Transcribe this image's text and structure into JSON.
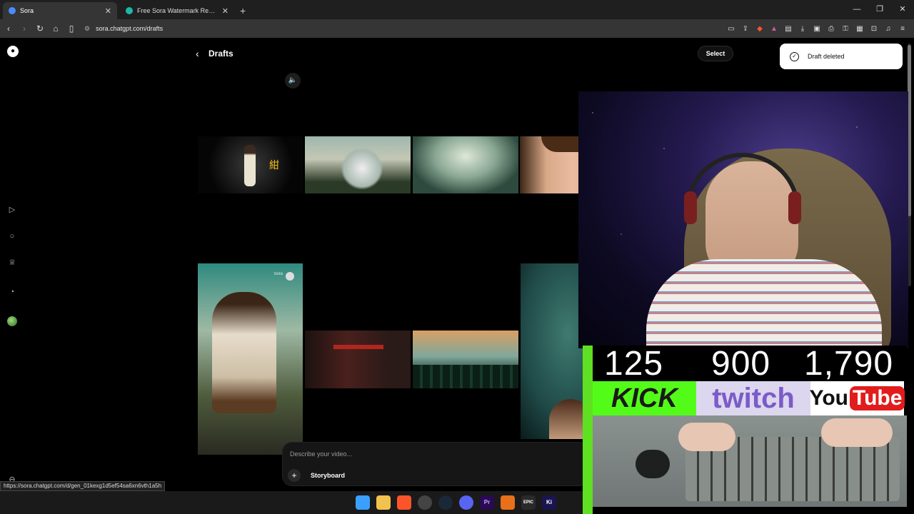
{
  "browser": {
    "tabs": [
      {
        "title": "Sora",
        "active": true,
        "close": "✕"
      },
      {
        "title": "Free Sora Watermark Remover – One",
        "active": false,
        "close": "✕"
      }
    ],
    "new_tab": "+",
    "url": "sora.chatgpt.com/drafts",
    "window_controls": [
      "—",
      "❐",
      "✕"
    ]
  },
  "page": {
    "title": "Drafts",
    "select_label": "Select",
    "toast": "Draft deleted",
    "prompt_placeholder": "Describe your video...",
    "storyboard_label": "Storyboard",
    "watermark": "Sora"
  },
  "status_url": "https://sora.chatgpt.com/d/gen_01kexg1d5ef54sa6xn6vth1a5h",
  "overlay": {
    "counts": [
      "125",
      "900",
      "1,790"
    ],
    "logos": {
      "kick": "KICK",
      "twitch": "twitch",
      "youtube_you": "You",
      "youtube_tube": "Tube"
    }
  },
  "taskbar": {
    "icons": [
      {
        "name": "windows-start-icon",
        "label": "",
        "color": "#3aa0ff"
      },
      {
        "name": "file-explorer-icon",
        "label": "",
        "color": "#f2c14e"
      },
      {
        "name": "brave-browser-icon",
        "label": "",
        "color": "#fb542b"
      },
      {
        "name": "obs-icon",
        "label": "",
        "color": "#444"
      },
      {
        "name": "steam-icon",
        "label": "",
        "color": "#1b2838"
      },
      {
        "name": "discord-icon",
        "label": "",
        "color": "#5865f2"
      },
      {
        "name": "premiere-icon",
        "label": "Pr",
        "color": "#2a0a52"
      },
      {
        "name": "app-orange-icon",
        "label": "",
        "color": "#e8701a"
      },
      {
        "name": "epic-games-icon",
        "label": "EPIC",
        "color": "#2a2a2a"
      },
      {
        "name": "ki-icon",
        "label": "Ki",
        "color": "#1a1450"
      }
    ]
  },
  "colors": {
    "accent_kick": "#53fc18",
    "twitch": "#7b5bc8",
    "youtube": "#e21c1c"
  }
}
